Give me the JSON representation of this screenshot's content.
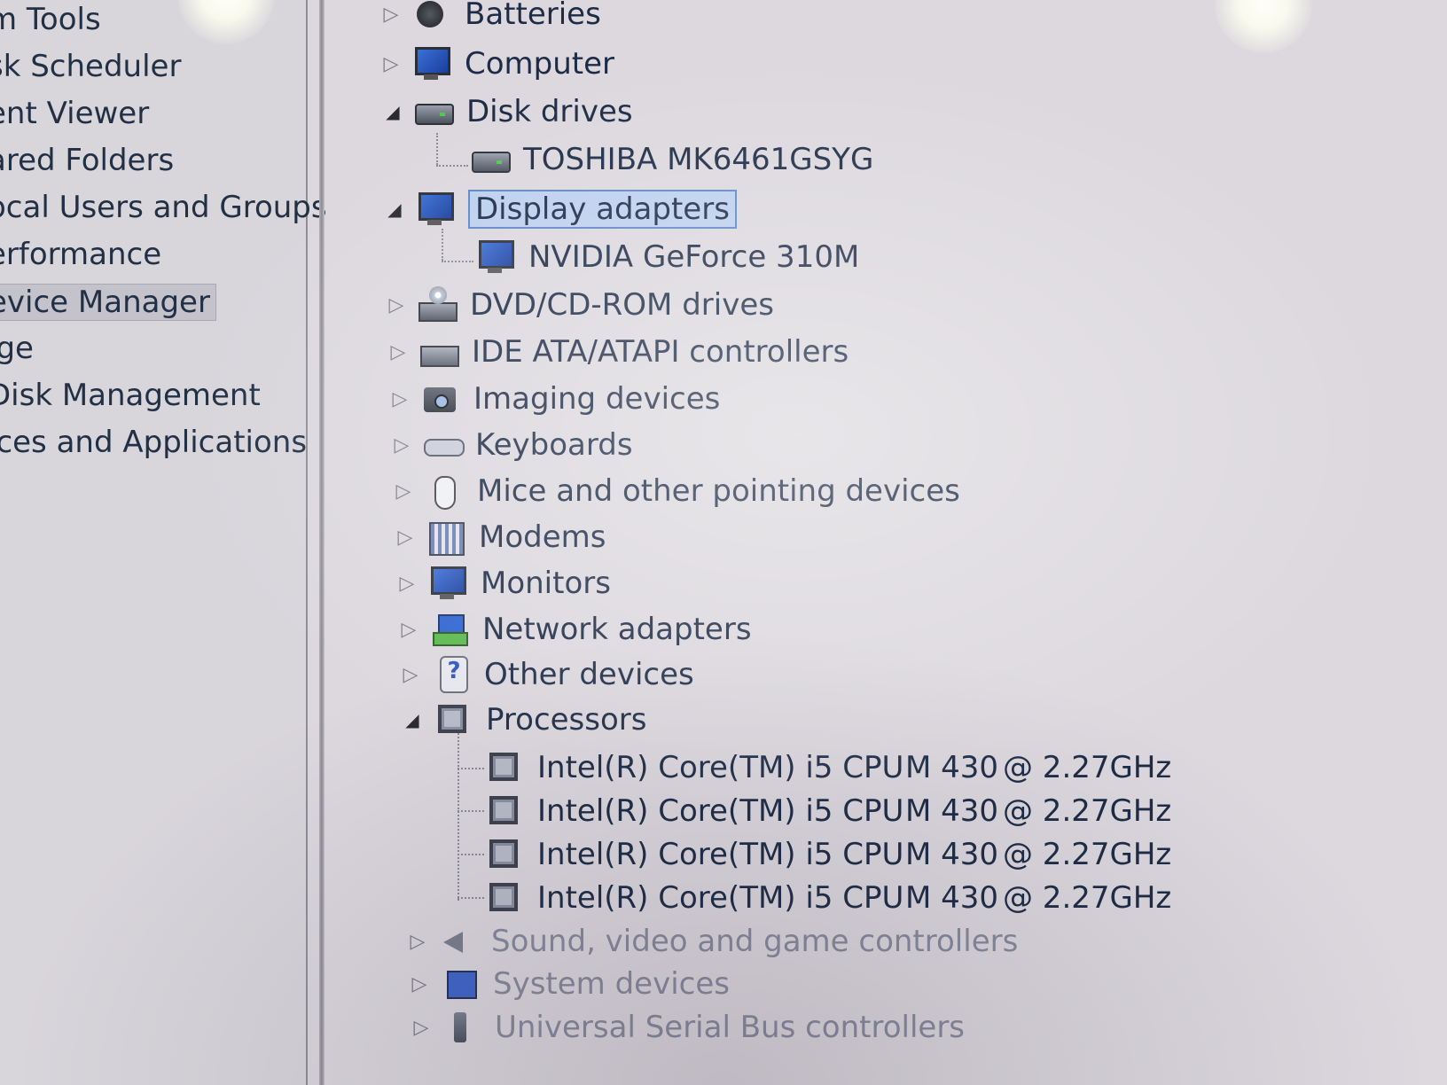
{
  "nav": {
    "items": [
      {
        "label": "m Tools"
      },
      {
        "label": "sk Scheduler"
      },
      {
        "label": "ent Viewer"
      },
      {
        "label": "ared Folders"
      },
      {
        "label": "ocal Users and Groups"
      },
      {
        "label": "erformance"
      },
      {
        "label": "evice Manager",
        "selected": true
      },
      {
        "label": "ige"
      },
      {
        "label": "Disk Management"
      },
      {
        "label": "ices and Applications"
      }
    ]
  },
  "tree": {
    "batteries": {
      "label": "Batteries",
      "icon": "battery-icon"
    },
    "computer": {
      "label": "Computer",
      "icon": "computer-icon"
    },
    "disk_drives": {
      "label": "Disk drives",
      "icon": "disk-drive-icon",
      "expanded": true,
      "children": [
        {
          "label": "TOSHIBA MK6461GSYG"
        }
      ]
    },
    "display_adapters": {
      "label": "Display adapters",
      "icon": "display-adapter-icon",
      "expanded": true,
      "selected": true,
      "children": [
        {
          "label": "NVIDIA GeForce 310M"
        }
      ]
    },
    "dvd": {
      "label": "DVD/CD-ROM drives",
      "icon": "dvd-drive-icon"
    },
    "ide": {
      "label": "IDE ATA/ATAPI controllers",
      "icon": "ide-controller-icon"
    },
    "imaging": {
      "label": "Imaging devices",
      "icon": "camera-icon"
    },
    "keyboards": {
      "label": "Keyboards",
      "icon": "keyboard-icon"
    },
    "mice": {
      "label": "Mice and other pointing devices",
      "icon": "mouse-icon"
    },
    "modems": {
      "label": "Modems",
      "icon": "modem-icon"
    },
    "monitors": {
      "label": "Monitors",
      "icon": "monitor-icon"
    },
    "network": {
      "label": "Network adapters",
      "icon": "network-adapter-icon"
    },
    "other": {
      "label": "Other devices",
      "icon": "unknown-device-icon"
    },
    "processors": {
      "label": "Processors",
      "icon": "processor-icon",
      "expanded": true,
      "children": [
        {
          "name": "Intel(R) Core(TM) i5 CPU",
          "model": "M 430",
          "speed": "@ 2.27GHz"
        },
        {
          "name": "Intel(R) Core(TM) i5 CPU",
          "model": "M 430",
          "speed": "@ 2.27GHz"
        },
        {
          "name": "Intel(R) Core(TM) i5 CPU",
          "model": "M 430",
          "speed": "@ 2.27GHz"
        },
        {
          "name": "Intel(R) Core(TM) i5 CPU",
          "model": "M 430",
          "speed": "@ 2.27GHz"
        }
      ]
    },
    "sound": {
      "label": "Sound, video and game controllers",
      "icon": "speaker-icon"
    },
    "system": {
      "label": "System devices",
      "icon": "system-device-icon"
    },
    "usb": {
      "label": "Universal Serial Bus controllers",
      "icon": "usb-icon"
    }
  },
  "glyphs": {
    "collapsed": "▷",
    "expanded": "◢"
  },
  "colors": {
    "selection_bg": "#bcd0ee",
    "selection_border": "#5f86c8",
    "text": "#1d2b46"
  }
}
